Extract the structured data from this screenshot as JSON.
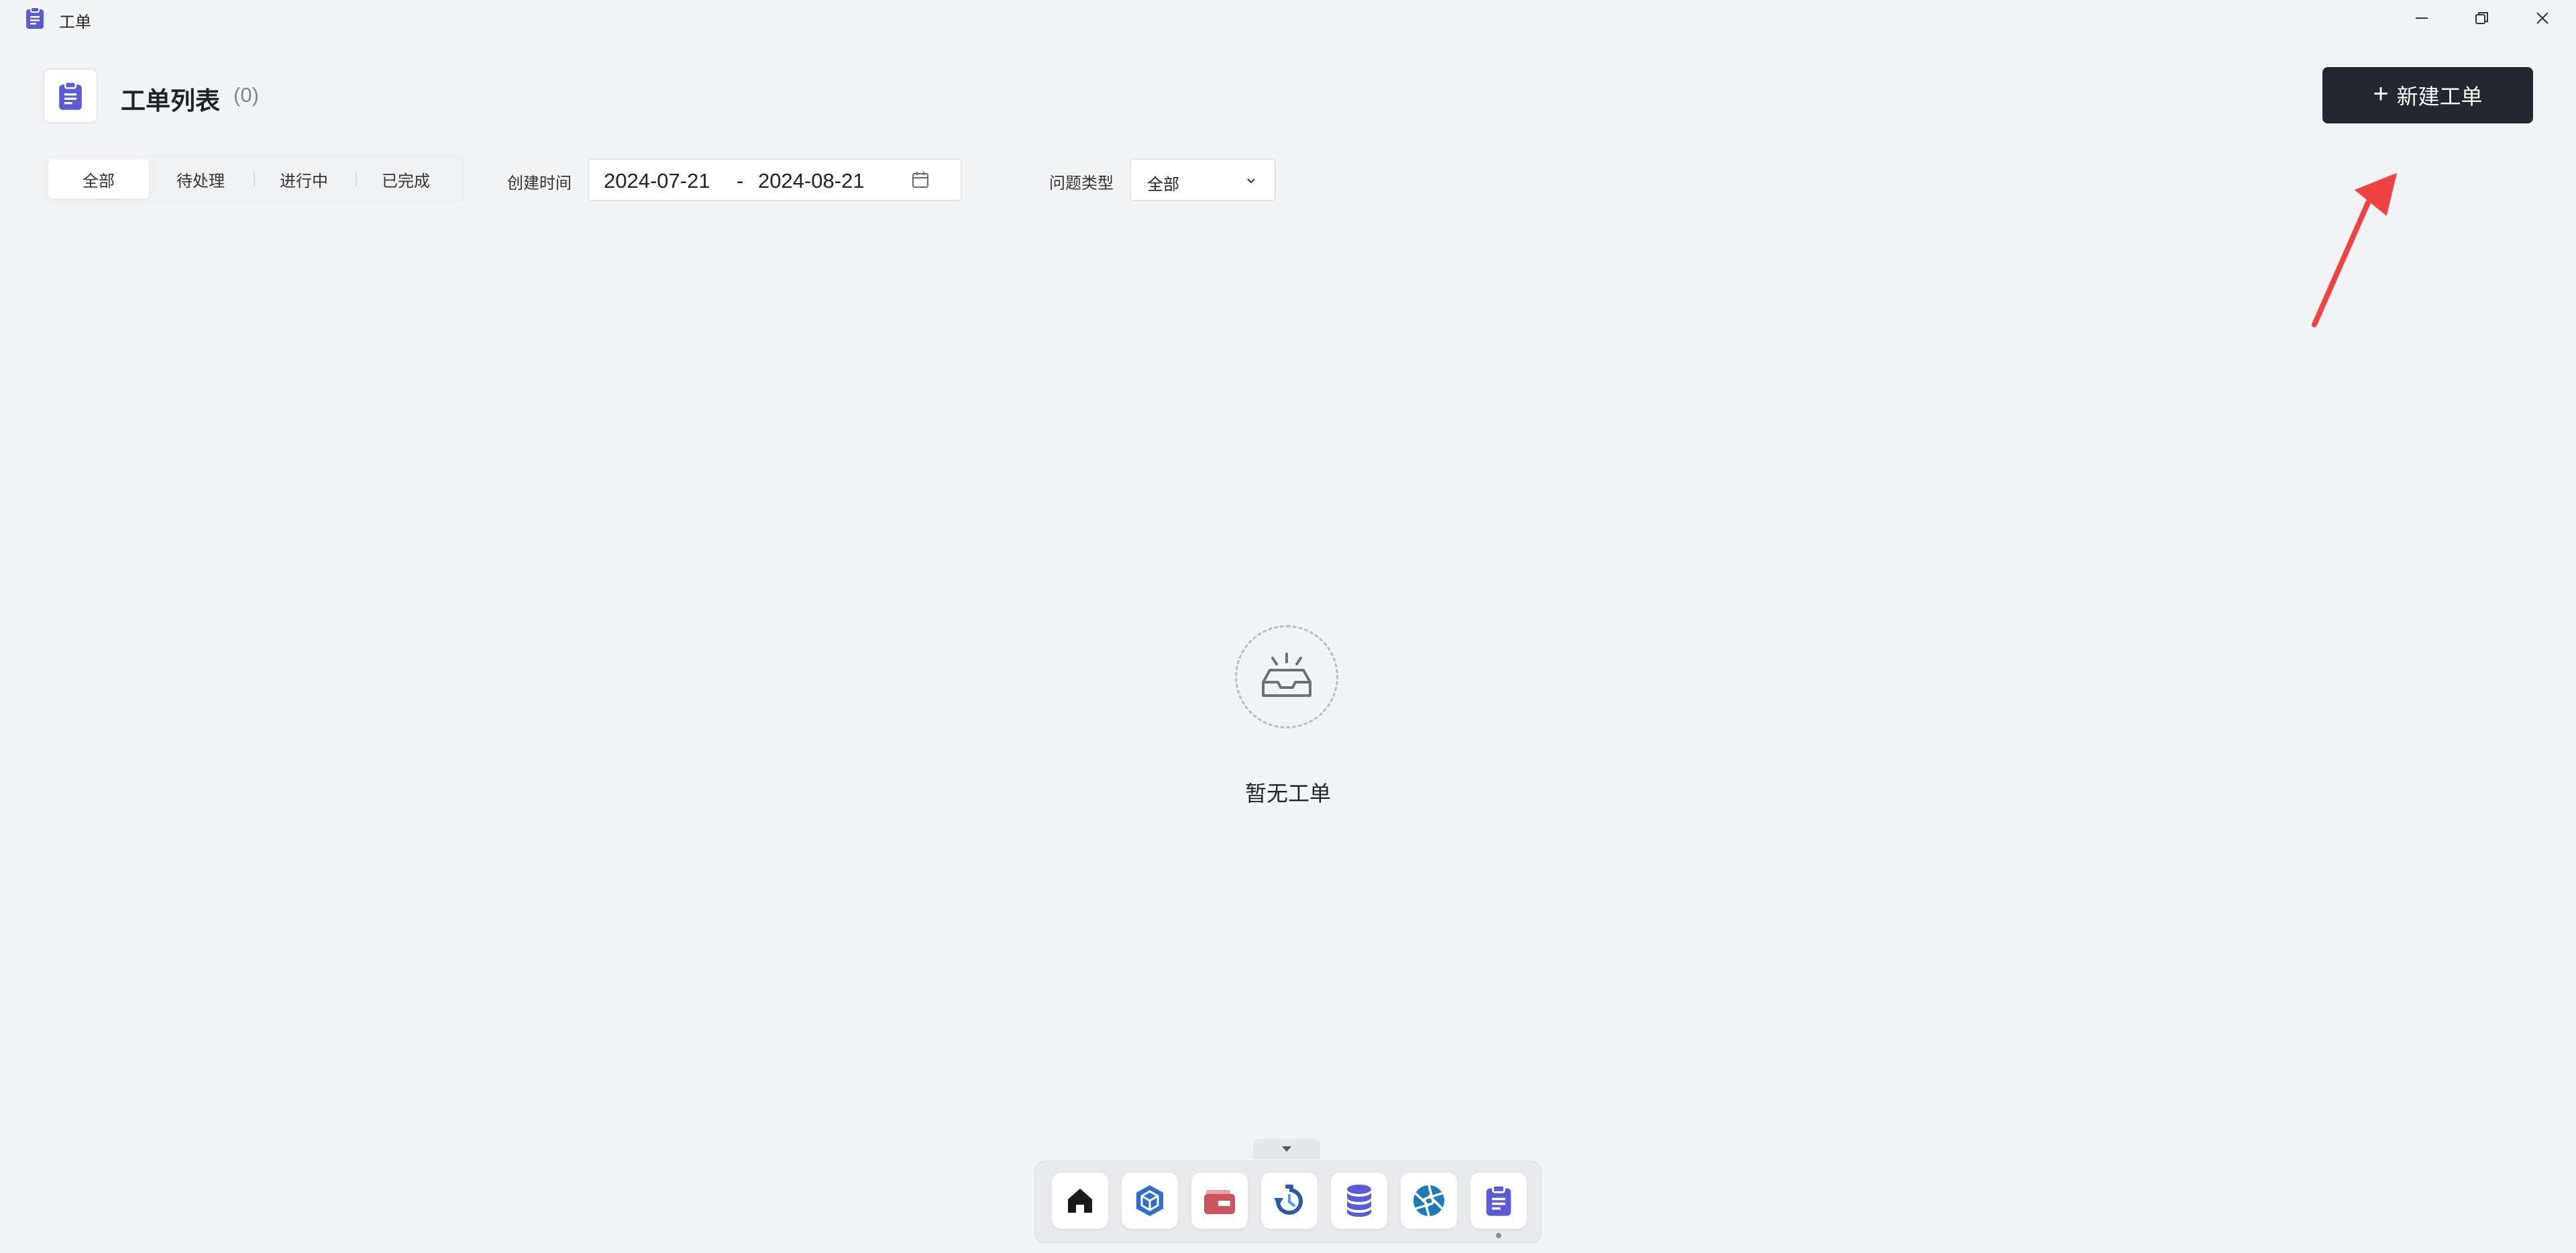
{
  "window": {
    "title": "工单"
  },
  "header": {
    "title": "工单列表",
    "count": "(0)",
    "new_button_label": "新建工单"
  },
  "filters": {
    "status_tabs": [
      {
        "label": "全部",
        "active": true
      },
      {
        "label": "待处理",
        "active": false
      },
      {
        "label": "进行中",
        "active": false
      },
      {
        "label": "已完成",
        "active": false
      }
    ],
    "created_time_label": "创建时间",
    "date_start": "2024-07-21",
    "date_separator": "-",
    "date_end": "2024-08-21",
    "issue_type_label": "问题类型",
    "issue_type_value": "全部"
  },
  "empty_state": {
    "text": "暂无工单"
  },
  "dock": {
    "items": [
      {
        "icon": "home-icon"
      },
      {
        "icon": "cube-icon"
      },
      {
        "icon": "wallet-icon"
      },
      {
        "icon": "backup-icon"
      },
      {
        "icon": "database-icon"
      },
      {
        "icon": "aperture-icon"
      },
      {
        "icon": "clipboard-icon"
      }
    ]
  },
  "colors": {
    "accent": "#5b5bd6",
    "primary_button": "#232730",
    "background": "#f3f4f6",
    "annotation_arrow": "#f04444"
  }
}
